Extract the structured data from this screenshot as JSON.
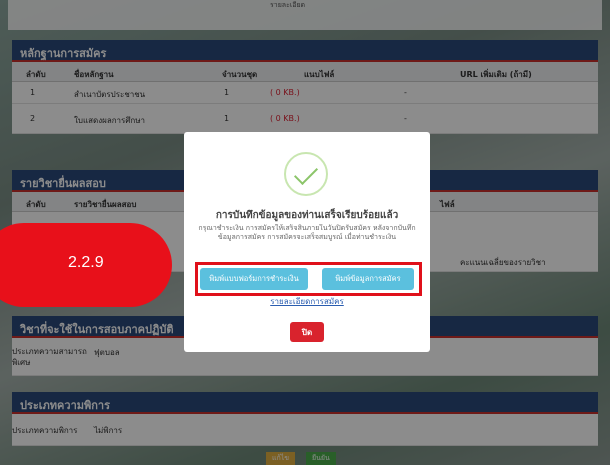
{
  "top_strip_text": "รายละเอียด",
  "sections": {
    "evidence": {
      "title": "หลักฐานการสมัคร",
      "headers": [
        "ลำดับ",
        "ชื่อหลักฐาน",
        "จำนวนชุด",
        "แนบไฟล์",
        "URL เพิ่มเติม (ถ้ามี)"
      ],
      "rows": [
        {
          "no": "1",
          "name": "สำเนาบัตรประชาชน",
          "qty": "1",
          "file": "( 0 KB.)",
          "url": "-"
        },
        {
          "no": "2",
          "name": "ใบแสดงผลการศึกษา",
          "qty": "1",
          "file": "( 0 KB.)",
          "url": "-"
        }
      ]
    },
    "subjects": {
      "title": "รายวิชายื่นผลสอบ",
      "headers": [
        "ลำดับ",
        "รายวิชายื่นผลสอบ",
        "ไฟล์"
      ],
      "score_header": "คะแนนเฉลี่ยของรายวิชา"
    },
    "practical": {
      "title": "วิชาที่จะใช้ในการสอบภาคปฏิบัติ",
      "label": "ประเภทความสามารถพิเศษ",
      "value": "ฟุตบอล"
    },
    "disability": {
      "title": "ประเภทความพิการ",
      "label": "ประเภทความพิการ",
      "value": "ไม่พิการ"
    }
  },
  "modal": {
    "title": "การบันทึกข้อมูลของท่านเสร็จเรียบร้อยแล้ว",
    "message": "กรุณาชำระเงิน การสมัครให้เสร็จสิ้นภายในวันปิดรับสมัคร หลังจากบันทึกข้อมูลการสมัคร การสมัครจะเสร็จสมบูรณ์ เมื่อท่านชำระเงิน",
    "print_payment_label": "พิมพ์แบบฟอร์มการชำระเงิน",
    "print_application_label": "พิมพ์ข้อมูลการสมัคร",
    "details_link": "รายละเอียดการสมัคร",
    "close_label": "ปิด"
  },
  "callout": "2.2.9",
  "bottom_buttons": {
    "edit": "แก้ไข",
    "confirm": "ยืนยัน"
  },
  "colors": {
    "header": "#2b4a7a",
    "accent": "#5bc0de",
    "close": "#d9232d",
    "callout": "#e8101a"
  }
}
